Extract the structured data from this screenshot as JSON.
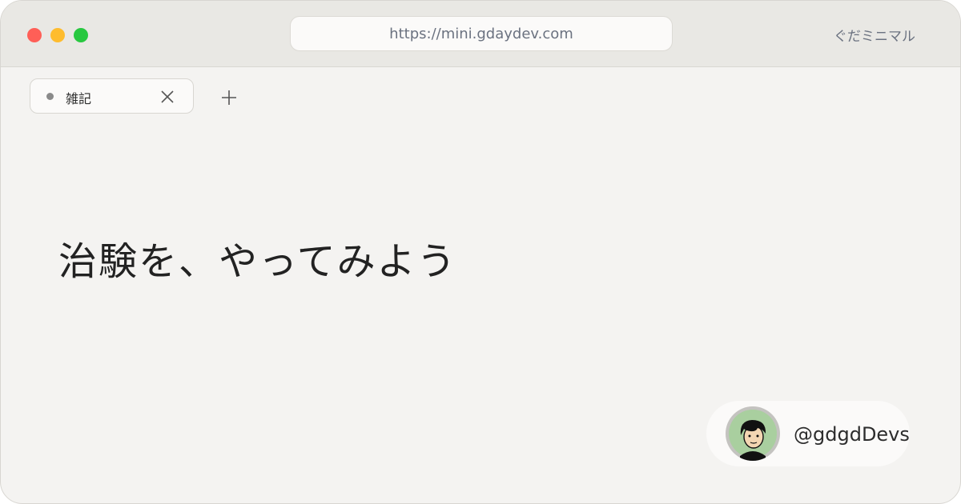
{
  "window": {
    "controls": {
      "close_color": "#ff5f57",
      "minimize_color": "#febc2e",
      "zoom_color": "#28c840"
    },
    "address_bar": {
      "url": "https://mini.gdaydev.com"
    },
    "site_name": "ぐだミニマル"
  },
  "tabs": [
    {
      "label": "雑記",
      "active": true,
      "close_icon": "close-icon"
    }
  ],
  "new_tab_icon": "plus-icon",
  "content": {
    "headline": "治験を、やってみよう"
  },
  "author": {
    "avatar_icon": "avatar-face-icon",
    "handle": "@gdgdDevs"
  }
}
